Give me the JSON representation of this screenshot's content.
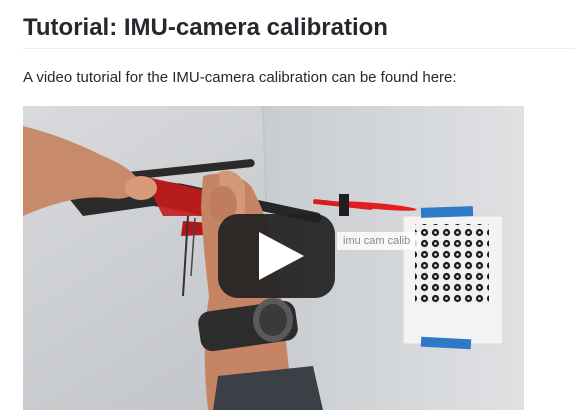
{
  "page": {
    "title": "Tutorial: IMU-camera calibration",
    "intro": "A video tutorial for the IMU-camera calibration can be found here:"
  },
  "video": {
    "overlay_label": "imu cam calib",
    "play_icon": "play-icon",
    "colors": {
      "play_button_bg": "#212121",
      "propeller_red": "#e11f1f",
      "tape_blue": "#2e79c8"
    }
  }
}
